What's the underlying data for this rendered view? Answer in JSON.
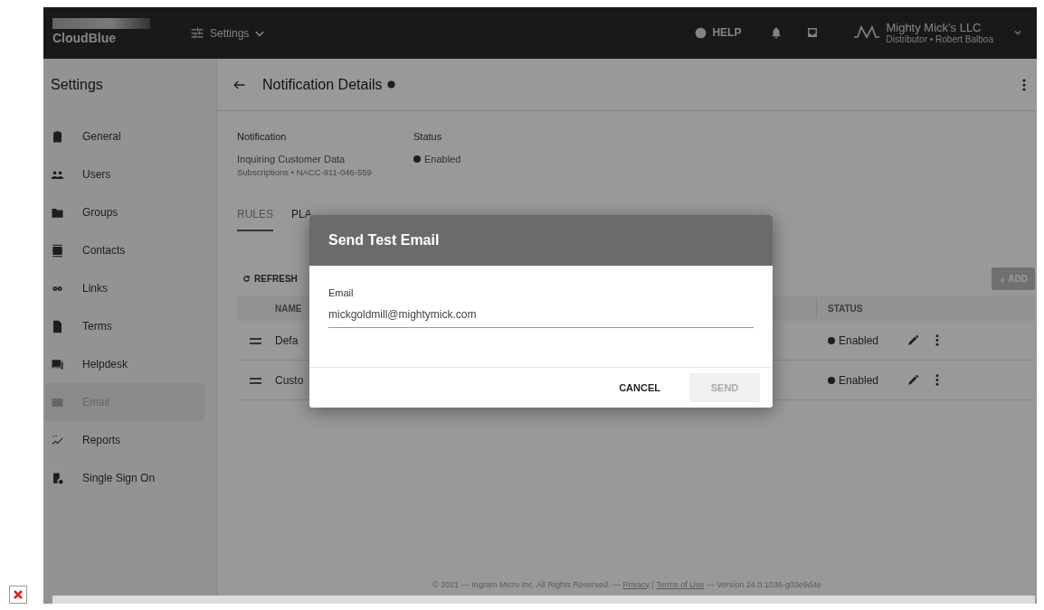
{
  "topbar": {
    "brand": "CloudBlue",
    "module": "Settings",
    "help": "HELP",
    "account": {
      "name": "Mighty Mick's LLC",
      "role": "Distributor • Robert Balboa"
    }
  },
  "sidebar": {
    "title": "Settings",
    "items": [
      {
        "label": "General",
        "selected": false
      },
      {
        "label": "Users",
        "selected": false
      },
      {
        "label": "Groups",
        "selected": false
      },
      {
        "label": "Contacts",
        "selected": false
      },
      {
        "label": "Links",
        "selected": false
      },
      {
        "label": "Terms",
        "selected": false
      },
      {
        "label": "Helpdesk",
        "selected": false
      },
      {
        "label": "Email",
        "selected": true
      },
      {
        "label": "Reports",
        "selected": false
      },
      {
        "label": "Single Sign On",
        "selected": false
      }
    ]
  },
  "header": {
    "title": "Notification Details"
  },
  "details": {
    "notification_label": "Notification",
    "notification_name": "Inquiring Customer Data",
    "notification_sub": "Subscriptions • NACC-911-046-559",
    "status_label": "Status",
    "status": "Enabled"
  },
  "tabs": [
    {
      "label": "RULES",
      "selected": true
    },
    {
      "label": "PLA",
      "selected": false
    }
  ],
  "toolbar": {
    "refresh": "REFRESH",
    "add": "ADD"
  },
  "table": {
    "columns": [
      "NAME",
      "STATUS"
    ],
    "rows": [
      {
        "name": "Defa",
        "status": "Enabled"
      },
      {
        "name": "Custo",
        "status": "Enabled"
      }
    ]
  },
  "footer": {
    "before": "© 2021 — Ingram Micro Inc. All Rights Reserved. —",
    "privacy": "Privacy",
    "separator": "|",
    "terms": "Terms of Use",
    "after": "— Version 24.0.1036-g03e9d4e"
  },
  "dialog": {
    "title": "Send Test Email",
    "field_label": "Email",
    "value": "mickgoldmill@mightymick.com",
    "cancel": "CANCEL",
    "send": "SEND",
    "send_disabled": true
  }
}
